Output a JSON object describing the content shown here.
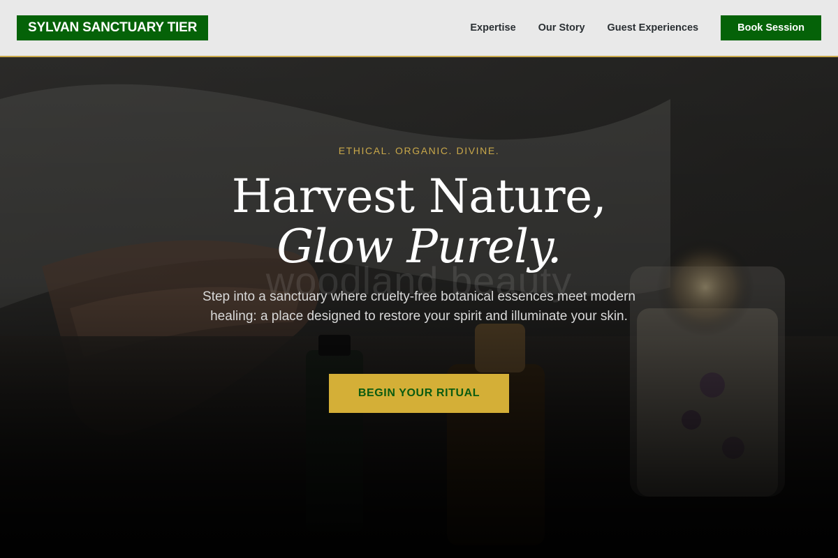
{
  "header": {
    "logo": "SYLVAN SANCTUARY TIER",
    "nav": [
      "Expertise",
      "Our Story",
      "Guest Experiences"
    ],
    "book_label": "Book Session"
  },
  "hero": {
    "eyebrow": "ETHICAL. ORGANIC. DIVINE.",
    "headline_line1": "Harvest Nature,",
    "headline_line2": "Glow Purely.",
    "ghost_text": "woodland beauty",
    "subtext": "Step into a sanctuary where cruelty-free botanical essences meet modern healing: a place designed to restore your spirit and illuminate your skin.",
    "cta_label": "BEGIN YOUR RITUAL"
  },
  "colors": {
    "brand_green": "#056208",
    "accent_gold": "#d4af37",
    "header_bg": "#e9e9e9"
  }
}
